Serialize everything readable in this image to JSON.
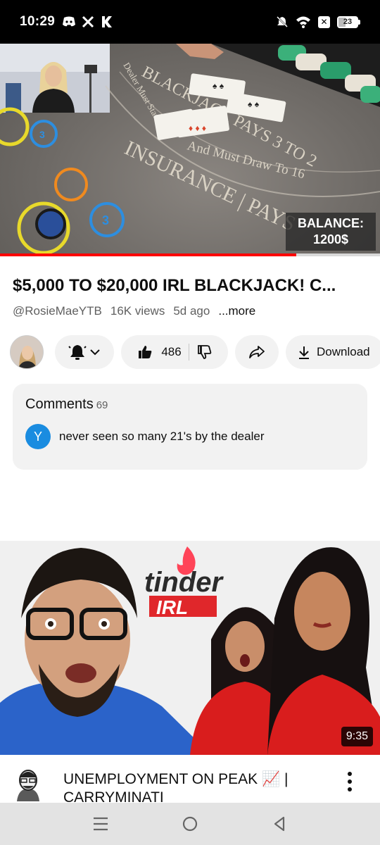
{
  "status_bar": {
    "time": "10:29",
    "left_icons": [
      "discord-icon",
      "x-logo-icon",
      "k-logo-icon"
    ],
    "right_icons": [
      "mute-icon",
      "wifi-icon",
      "x-badge-icon",
      "battery-icon"
    ],
    "battery_level": "23"
  },
  "video": {
    "balance_label": "BALANCE:",
    "balance_value": "1200$",
    "table_text_1": "BLACKJACK PAYS 3 TO 2",
    "table_text_2": "Dealer Must Stand",
    "table_text_3": "And Must Draw To 16",
    "table_text_4": "INSURANCE | PAYS",
    "progress_fraction": 0.78
  },
  "details": {
    "title": "$5,000 TO $20,000 IRL BLACKJACK! C...",
    "channel": "@RosieMaeYTB",
    "views": "16K views",
    "age": "5d ago",
    "more_label": "...more"
  },
  "actions": {
    "like_count": "486",
    "download_label": "Download"
  },
  "comments": {
    "header": "Comments",
    "count": "69",
    "first_initial": "Y",
    "first_text": "never seen so many 21's by the dealer"
  },
  "next_video": {
    "thumb_text_1": "tinder",
    "thumb_text_2": "IRL",
    "duration": "9:35",
    "title": "UNEMPLOYMENT ON PEAK 📈 | CARRYMINATI"
  },
  "colors": {
    "accent_red": "#ff0000",
    "pill_bg": "#f2f2f2",
    "comment_avatar": "#1a8ce0",
    "tinder_red": "#e0272b"
  }
}
